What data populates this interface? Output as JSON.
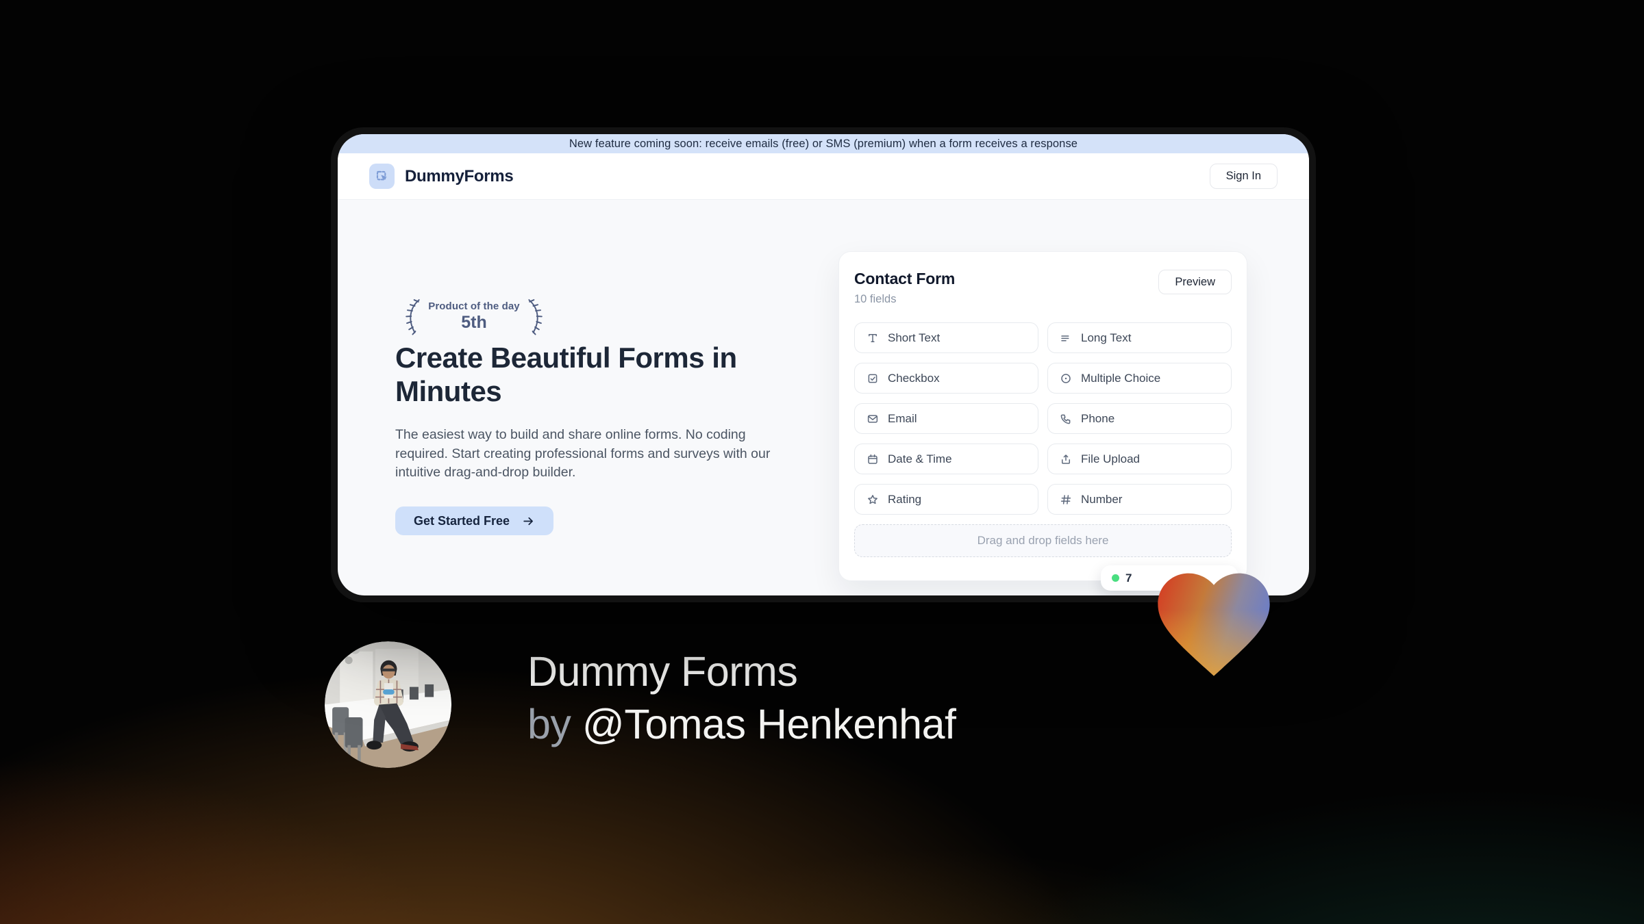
{
  "banner": {
    "text": "New feature coming soon: receive emails (free) or SMS (premium) when a form receives a response"
  },
  "header": {
    "brand": "DummyForms",
    "sign_in_label": "Sign In"
  },
  "hero": {
    "award": {
      "line1": "Product of the day",
      "line2": "5th"
    },
    "title": "Create Beautiful Forms in Minutes",
    "description": "The easiest way to build and share online forms. No coding required. Start creating professional forms and surveys with our intuitive drag-and-drop builder.",
    "cta_label": "Get Started Free"
  },
  "form_card": {
    "title": "Contact Form",
    "subtitle": "10 fields",
    "preview_label": "Preview",
    "fields": [
      {
        "label": "Short Text",
        "icon": "short-text-icon"
      },
      {
        "label": "Long Text",
        "icon": "long-text-icon"
      },
      {
        "label": "Checkbox",
        "icon": "checkbox-icon"
      },
      {
        "label": "Multiple Choice",
        "icon": "multiple-choice-icon"
      },
      {
        "label": "Email",
        "icon": "email-icon"
      },
      {
        "label": "Phone",
        "icon": "phone-icon"
      },
      {
        "label": "Date & Time",
        "icon": "calendar-icon"
      },
      {
        "label": "File Upload",
        "icon": "upload-icon"
      },
      {
        "label": "Rating",
        "icon": "star-icon"
      },
      {
        "label": "Number",
        "icon": "hash-icon"
      }
    ],
    "dropzone_text": "Drag and drop fields here",
    "response_badge": {
      "visible_text": "7",
      "dot_color": "#4ade80"
    }
  },
  "footer": {
    "product_name": "Dummy Forms",
    "byline_prefix": "by",
    "author": "@Tomas Henkenhaf"
  },
  "colors": {
    "accent_blue": "#cfe0fa",
    "banner_blue": "#d4e2f9",
    "status_green": "#4ade80",
    "heart_red": "#d53a22",
    "heart_orange": "#efa42e",
    "heart_blue": "#6e7ec4"
  }
}
